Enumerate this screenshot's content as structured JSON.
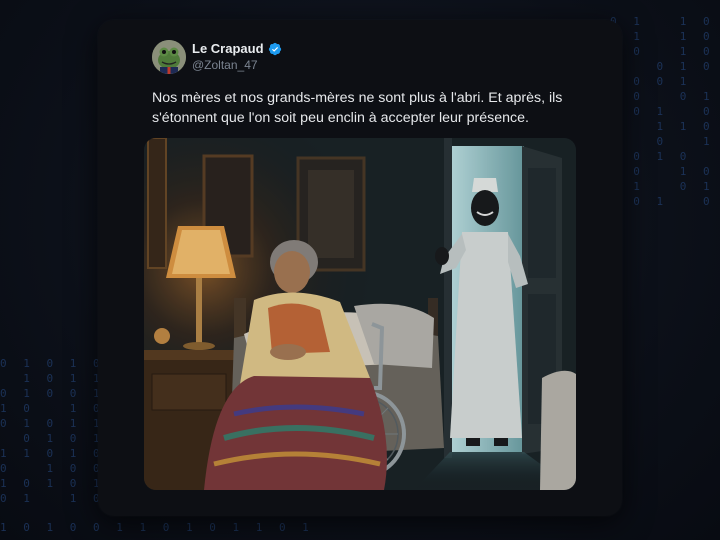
{
  "background": {
    "digits_right": "0 1   1 0 1\n0 1   1 0 1\n  0   1 0\n1   0 1 0 1\n  0 0 1   0\n1 0   0 1\n  0 1   0 1\n0   1 1 0\n1   0   1 0\n  0 1 0   1\n0 0   1 0\n  1   0 1 0\n1 0 1   0",
    "digits_left": "0 1 0 1 0\n  1 0 1 1\n0 1 0 0 1\n1 0   1 0\n0 1 0 1 1\n  0 1 0 1\n1 1 0 1 0\n0   1 0 0\n1 0 1 0 1\n0 1   1 0",
    "digits_bottom": "1 0 1 0 0 1 1 0 1 0 1 1 0 1"
  },
  "tweet": {
    "author_name": "Le Crapaud",
    "handle": "@Zoltan_47",
    "verified": true,
    "text": "Nos mères et nos grands-mères ne sont plus à l'abri. Et après, ils s'étonnent que l'on soit peu enclin à accepter leur présence.",
    "accent_color": "#1d9bf0"
  },
  "icons": {
    "verified": "verified-badge-icon",
    "avatar": "frog-avatar"
  }
}
